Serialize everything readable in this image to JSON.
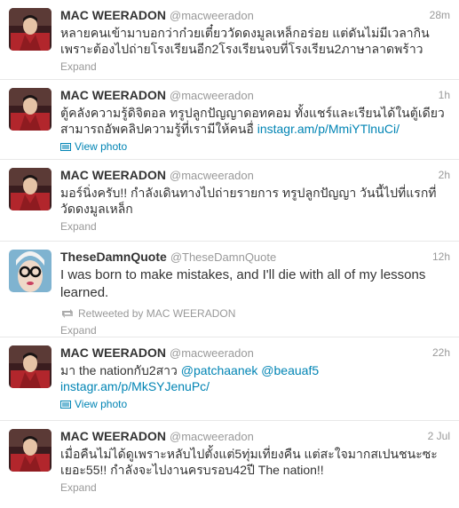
{
  "tweets": [
    {
      "fullname": "MAC WEERADON",
      "username": "@macweeradon",
      "time": "28m",
      "text": "หลายคนเข้ามาบอกว่าก๋วยเตี๋ยววัดดงมูลเหล็กอร่อย แต่ดันไม่มีเวลากินเพราะต้องไปถ่ายโรงเรียนอีก2โรงเรียนจบที่โรงเรียน2ภาษาลาดพร้าว",
      "action": "Expand",
      "avatar_icon": "profile-photo-red-shirt"
    },
    {
      "fullname": "MAC WEERADON",
      "username": "@macweeradon",
      "time": "1h",
      "text": "ตู้คลังความรู้ดิจิตอล ทรูปลูกปัญญาดอทคอม ทั้งแชร์และเรียนได้ในตู้เดียว สามารถอัพคลิปความรู้ที่เรามีให้คนอื่ ",
      "link": "instagr.am/p/MmiYTlnuCi/",
      "action": "View photo",
      "action_icon": "photo-icon",
      "avatar_icon": "profile-photo-red-shirt"
    },
    {
      "fullname": "MAC WEERADON",
      "username": "@macweeradon",
      "time": "2h",
      "text": "มอร์นิ่งครับ!! กำลังเดินทางไปถ่ายรายการ ทรูปลูกปัญญา วันนี้ไปที่แรกที่วัดดงมูลเหล็ก",
      "action": "Expand",
      "avatar_icon": "profile-photo-red-shirt"
    },
    {
      "fullname": "TheseDamnQuote",
      "username": "@TheseDamnQuote",
      "time": "12h",
      "text": "I was born to make mistakes, and I'll die with all of my lessons learned.",
      "retweeted_by": "Retweeted by MAC WEERADON",
      "retweet_icon": "retweet-icon",
      "action": "Expand",
      "avatar_icon": "profile-photo-glasses-woman"
    },
    {
      "fullname": "MAC WEERADON",
      "username": "@macweeradon",
      "time": "22h",
      "text_prefix": "มา the nationกับ2สาว ",
      "mention1": "@patchaanek",
      "mention2": "@beauaf5",
      "link": "instagr.am/p/MkSYJenuPc/",
      "action": "View photo",
      "action_icon": "photo-icon",
      "avatar_icon": "profile-photo-red-shirt"
    },
    {
      "fullname": "MAC WEERADON",
      "username": "@macweeradon",
      "time": "2 Jul",
      "text": "เมื่อคืนไม่ได้ดูเพราะหลับไปตั้งแต่5ทุ่มเที่ยงคืน แต่สะใจมากสเปนชนะซะเยอะ55!! กำลังจะไปงานครบรอบ42ปี The nation!!",
      "action": "Expand",
      "avatar_icon": "profile-photo-red-shirt"
    }
  ],
  "colors": {
    "link": "#0084b4",
    "secondary": "#999999",
    "text": "#333333",
    "divider": "#e8e8e8"
  }
}
